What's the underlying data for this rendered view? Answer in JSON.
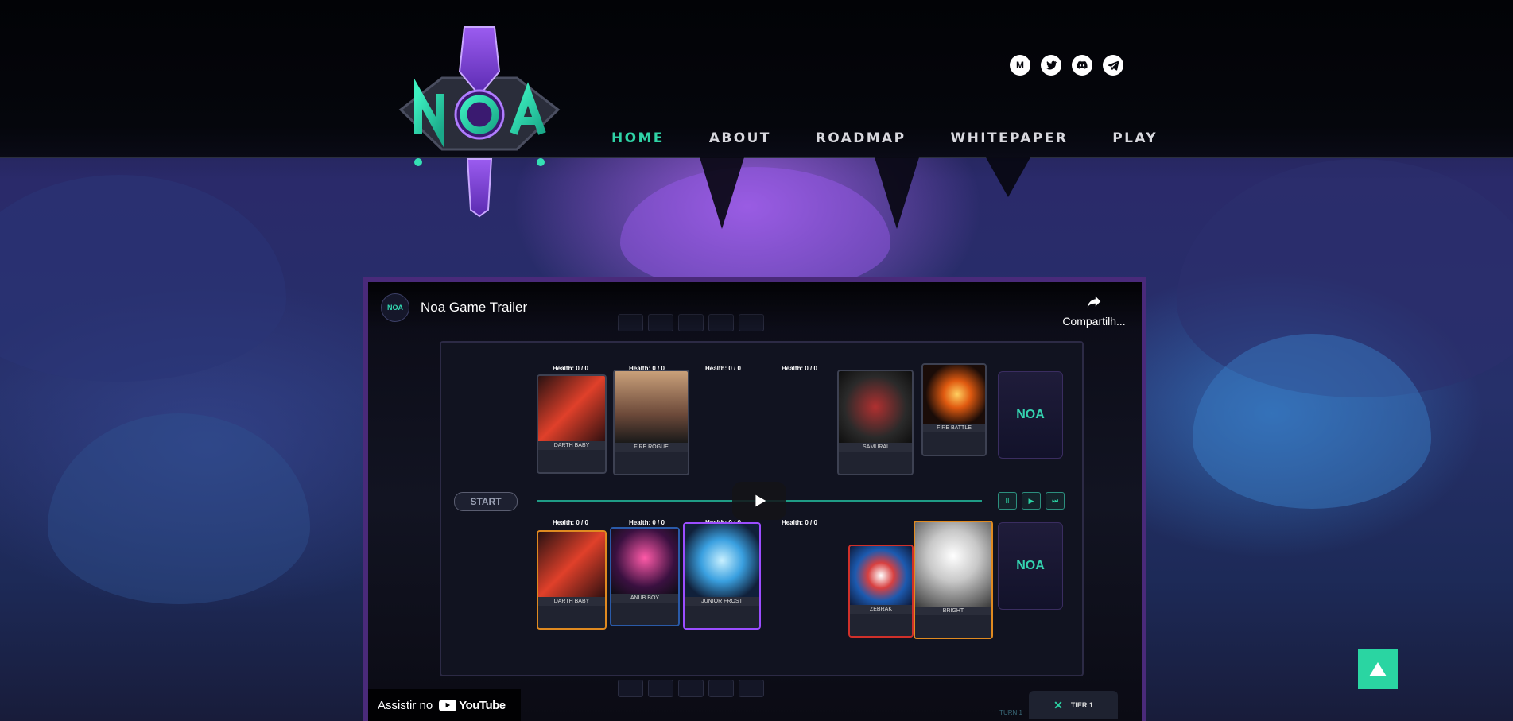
{
  "brand": {
    "name": "NOA",
    "logo_icon": "noa-emblem-icon"
  },
  "social": [
    {
      "id": "medium",
      "label": "M",
      "icon": "medium-icon"
    },
    {
      "id": "twitter",
      "icon": "twitter-icon"
    },
    {
      "id": "discord",
      "icon": "discord-icon"
    },
    {
      "id": "telegram",
      "icon": "telegram-icon"
    }
  ],
  "nav": {
    "home": "HOME",
    "about": "ABOUT",
    "roadmap": "ROADMAP",
    "whitepaper": "WHITEPAPER",
    "play": "PLAY"
  },
  "video": {
    "title": "Noa Game Trailer",
    "channel_logo_text": "NOA",
    "share_label": "Compartilh...",
    "watch_on": "Assistir no",
    "youtube": "YouTube",
    "start": "START",
    "turn": "TURN 1",
    "tier": "TIER 1",
    "deck_label": "NOA",
    "health_label": "Health: 0 / 0",
    "top_cards": [
      "DARTH BABY",
      "FIRE ROGUE",
      "SAMURAI",
      "FIRE BATTLE"
    ],
    "bottom_cards": [
      "DARTH BABY",
      "ANUB BOY",
      "JUNIOR FROST",
      "ZEBRAK",
      "BRIGHT"
    ]
  },
  "colors": {
    "accent": "#2fd3a6",
    "nav_text": "#d8d8de",
    "frame": "#4a2a7a",
    "scroll_top": "#2ad5a2"
  }
}
